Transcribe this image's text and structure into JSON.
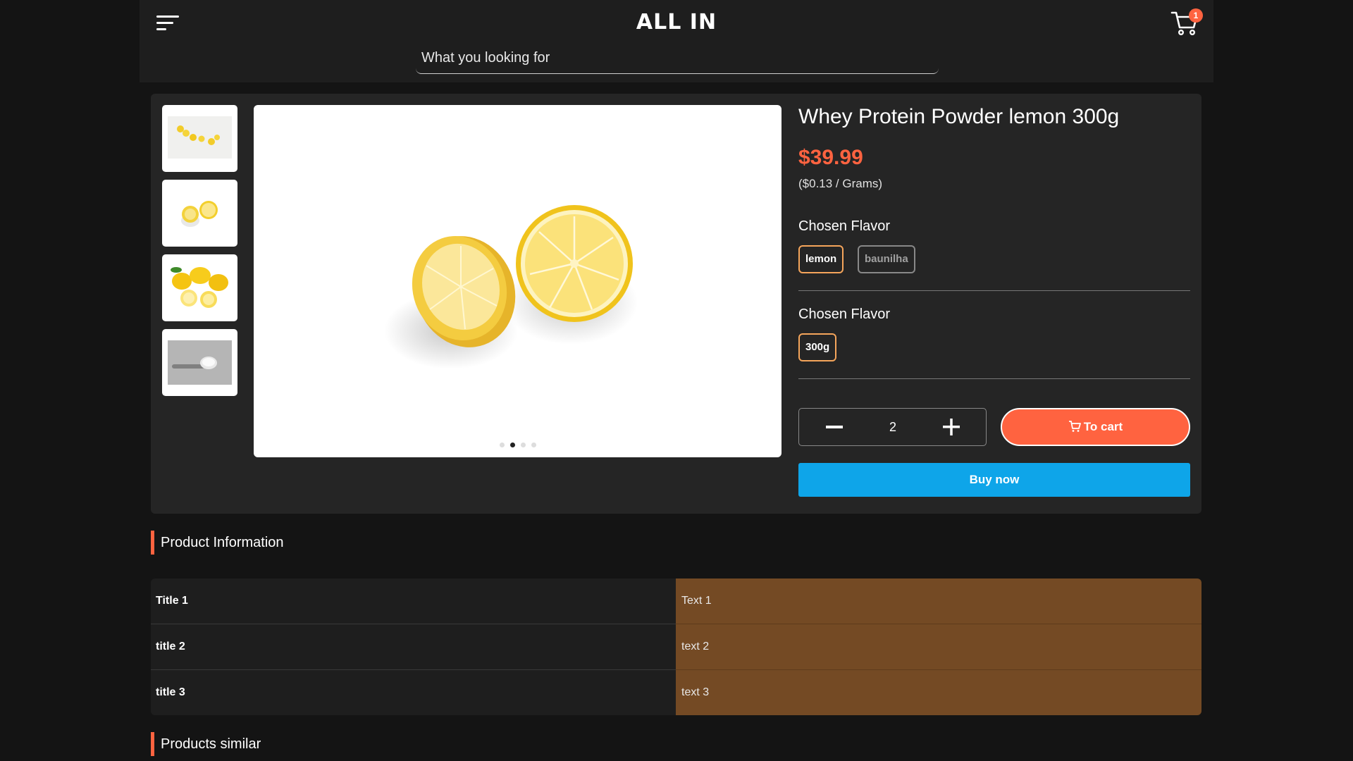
{
  "header": {
    "brand": "ALL IN",
    "search_placeholder": "What you looking for",
    "cart_count": "1"
  },
  "gallery": {
    "thumbnails": [
      "lemon-drops-thumbnail",
      "lemon-halves-thumbnail",
      "lemons-pile-thumbnail",
      "powder-scoop-thumbnail"
    ],
    "active_slide": 2,
    "slide_count": 4
  },
  "product": {
    "title": "Whey Protein Powder lemon 300g",
    "price": "$39.99",
    "unit_price": "($0.13 / Grams)",
    "flavor_label": "Chosen Flavor",
    "flavors": [
      "lemon",
      "baunilha"
    ],
    "selected_flavor": "lemon",
    "size_label": "Chosen Flavor",
    "sizes": [
      "300g"
    ],
    "selected_size": "300g",
    "quantity": "2",
    "to_cart_label": "To cart",
    "buy_now_label": "Buy now"
  },
  "product_information": {
    "heading": "Product Information",
    "rows": [
      {
        "title": "Title 1",
        "text": "Text 1"
      },
      {
        "title": "title 2",
        "text": "text 2"
      },
      {
        "title": "title 3",
        "text": "text 3"
      }
    ]
  },
  "similar": {
    "heading": "Products similar"
  },
  "colors": {
    "accent": "#ff6340",
    "buy_now": "#0ea5e9",
    "table_value_bg": "#744a24",
    "selected_option_border": "#f5a55b"
  }
}
